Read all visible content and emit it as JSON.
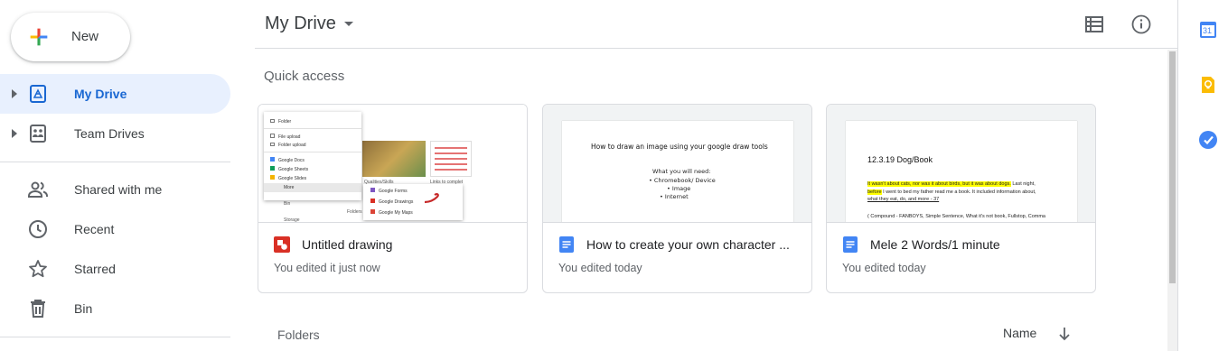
{
  "sidebar": {
    "new_label": "New",
    "items": [
      {
        "label": "My Drive",
        "icon": "my-drive-icon",
        "active": true
      },
      {
        "label": "Team Drives",
        "icon": "team-drives-icon"
      },
      {
        "label": "Shared with me",
        "icon": "shared-people-icon"
      },
      {
        "label": "Recent",
        "icon": "clock-icon"
      },
      {
        "label": "Starred",
        "icon": "star-icon"
      },
      {
        "label": "Bin",
        "icon": "trash-icon"
      }
    ]
  },
  "header": {
    "title": "My Drive",
    "icons": [
      "list-view-icon",
      "info-icon"
    ]
  },
  "main": {
    "quick_access_label": "Quick access",
    "cards": [
      {
        "name": "Untitled drawing",
        "subtitle": "You edited it just now",
        "type": "drawing",
        "icon": "google-drawings-icon",
        "thumb": {
          "menu_items": [
            "Folder",
            "File upload",
            "Folder upload",
            "Google Docs",
            "Google Sheets",
            "Google Slides",
            "More"
          ],
          "submenu_items": [
            "Google Forms",
            "Google Drawings",
            "Google My Maps"
          ],
          "bg_labels": [
            "Qualities/Skills",
            "Links to complet",
            "Bin",
            "Storage",
            "Folders"
          ]
        }
      },
      {
        "name": "How to create your own character ...",
        "subtitle": "You edited today",
        "type": "doc",
        "icon": "google-docs-icon",
        "thumb": {
          "title": "How to draw an image using your google draw tools",
          "intro": "What you will need:",
          "bullets": [
            "Chromebook/ Device",
            "Image",
            "Internet"
          ]
        }
      },
      {
        "name": "Mele 2 Words/1 minute",
        "subtitle": "You edited today",
        "type": "doc",
        "icon": "google-docs-icon",
        "thumb": {
          "title": "12.3.19 Dog/Book",
          "hl1": "It wasn't about cats, nor was it about birds, but it was about dogs.",
          "text1": " Last night,",
          "hl2": "before",
          "text2": " I went to bed my father read me a book. It included information about,",
          "line3": "what they eat, do, and more - 37",
          "line4": "( Compound - FANBOYS, Simple Sentence, What it's not book, Fullstop, Comma"
        }
      }
    ],
    "folders_label": "Folders",
    "sort_label": "Name"
  },
  "side_panel": {
    "calendar_day": "31",
    "icons": [
      "google-calendar-icon",
      "google-keep-icon",
      "google-tasks-icon"
    ]
  },
  "colors": {
    "accent": "#1a73e8",
    "active_bg": "#e8f0fe",
    "active_text": "#1967d2",
    "drawings_red": "#d93025",
    "docs_blue": "#4285f4",
    "keep_yellow": "#fbbc04"
  }
}
